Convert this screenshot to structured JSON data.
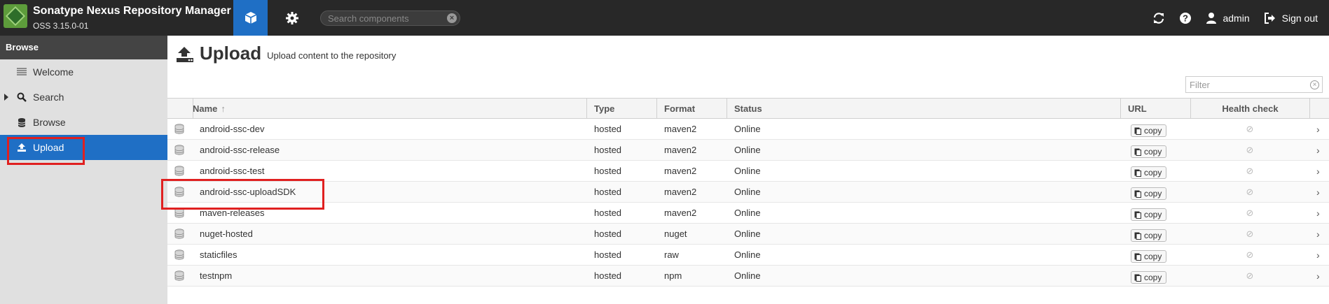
{
  "header": {
    "title": "Sonatype Nexus Repository Manager",
    "version": "OSS 3.15.0-01",
    "search_placeholder": "Search components",
    "user": "admin",
    "signout": "Sign out"
  },
  "sidebar": {
    "header": "Browse",
    "items": [
      {
        "label": "Welcome",
        "icon": "welcome-icon"
      },
      {
        "label": "Search",
        "icon": "search-icon"
      },
      {
        "label": "Browse",
        "icon": "database-icon"
      },
      {
        "label": "Upload",
        "icon": "upload-icon"
      }
    ]
  },
  "page": {
    "title": "Upload",
    "subtitle": "Upload content to the repository",
    "filter_placeholder": "Filter"
  },
  "grid": {
    "columns": [
      "Name",
      "Type",
      "Format",
      "Status",
      "URL",
      "Health check"
    ],
    "copy_label": "copy",
    "rows": [
      {
        "name": "android-ssc-dev",
        "type": "hosted",
        "format": "maven2",
        "status": "Online"
      },
      {
        "name": "android-ssc-release",
        "type": "hosted",
        "format": "maven2",
        "status": "Online"
      },
      {
        "name": "android-ssc-test",
        "type": "hosted",
        "format": "maven2",
        "status": "Online"
      },
      {
        "name": "android-ssc-uploadSDK",
        "type": "hosted",
        "format": "maven2",
        "status": "Online"
      },
      {
        "name": "maven-releases",
        "type": "hosted",
        "format": "maven2",
        "status": "Online"
      },
      {
        "name": "nuget-hosted",
        "type": "hosted",
        "format": "nuget",
        "status": "Online"
      },
      {
        "name": "staticfiles",
        "type": "hosted",
        "format": "raw",
        "status": "Online"
      },
      {
        "name": "testnpm",
        "type": "hosted",
        "format": "npm",
        "status": "Online"
      }
    ]
  },
  "colors": {
    "accent": "#1f6fc5",
    "topbar": "#282828",
    "highlight": "#e02020"
  }
}
